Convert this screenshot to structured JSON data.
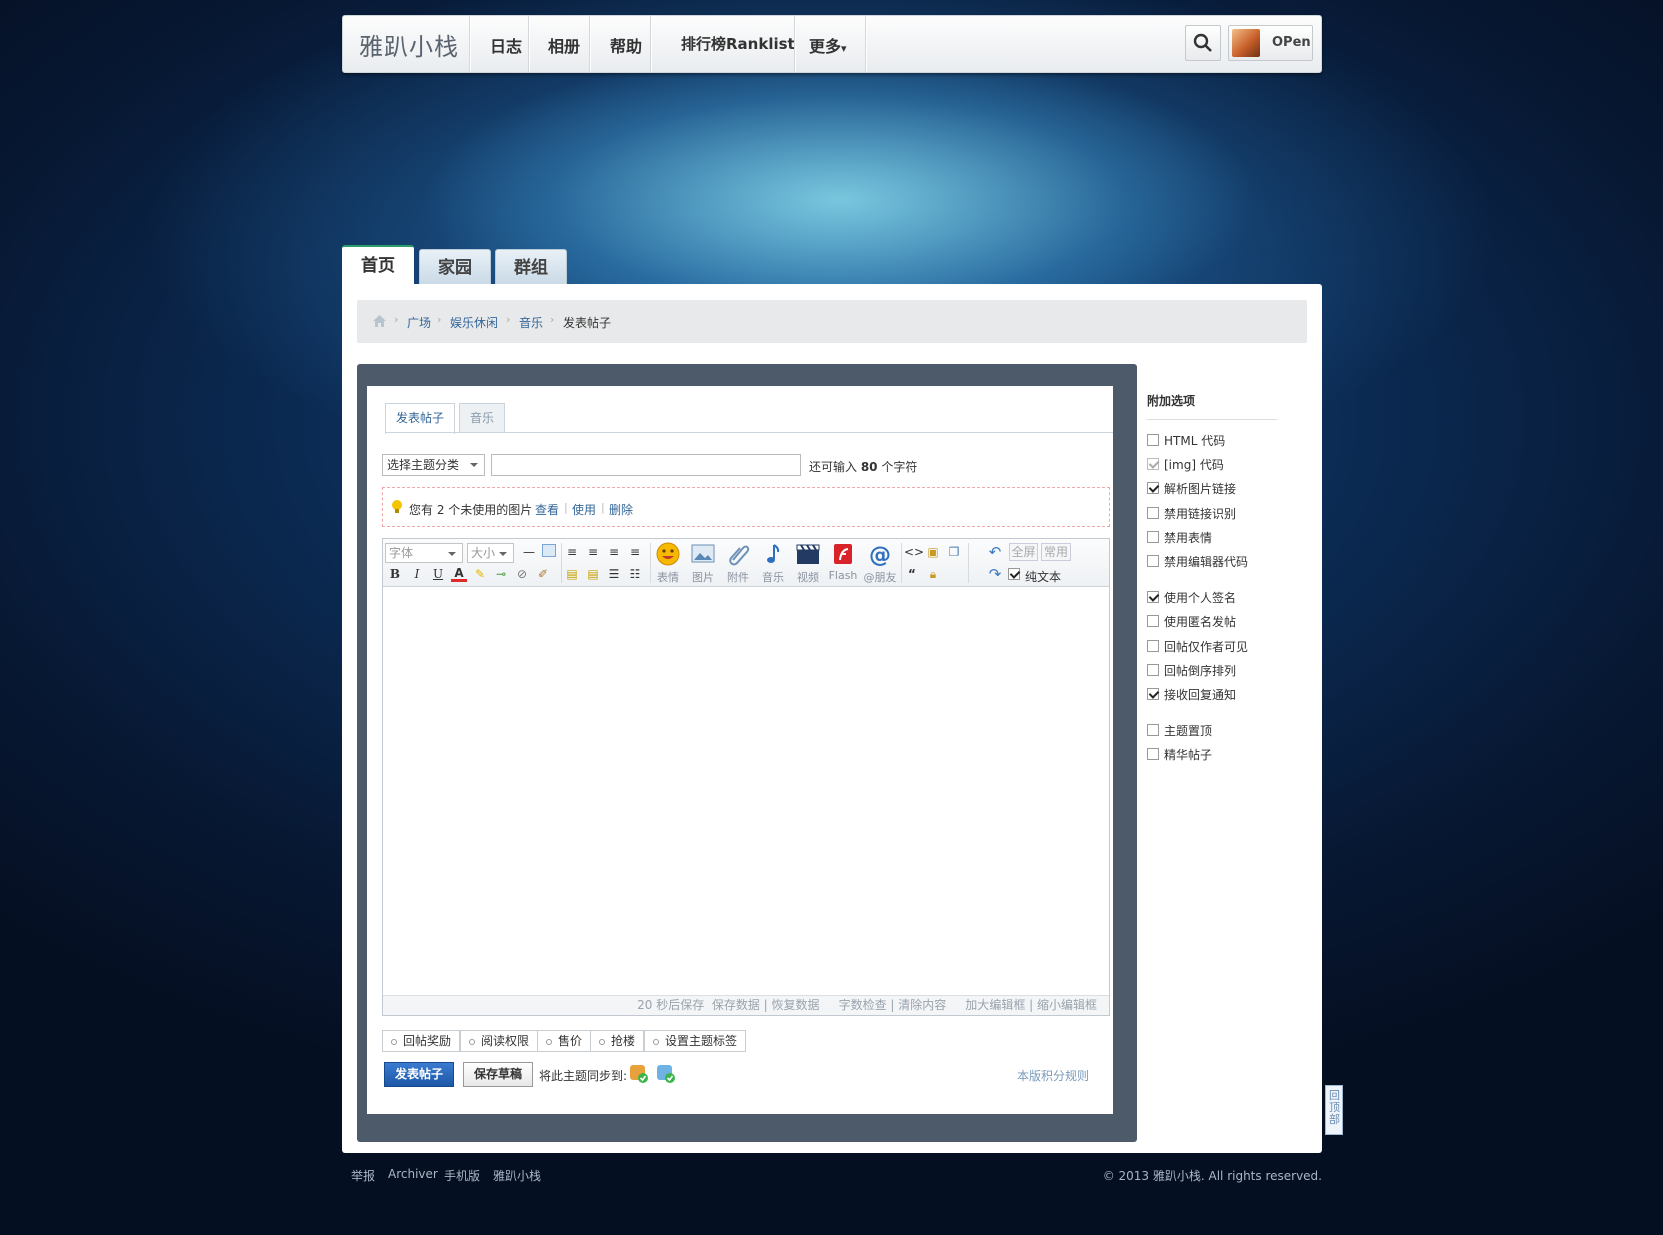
{
  "nav": {
    "logo": "雅趴小栈",
    "items": [
      "日志",
      "相册",
      "帮助",
      "排行榜Ranklist",
      "更多"
    ],
    "more_caret": "▾",
    "username": "OPen"
  },
  "tabs": [
    "首页",
    "家园",
    "群组"
  ],
  "breadcrumb": [
    "广场",
    "娱乐休闲",
    "音乐",
    "发表帖子"
  ],
  "editor_tabs": [
    "发表帖子",
    "音乐"
  ],
  "topic_select": "选择主题分类",
  "remain": {
    "prefix": "还可输入 ",
    "count": "80",
    "suffix": " 个字符"
  },
  "notice": {
    "text": "您有 2 个未使用的图片",
    "links": [
      "查看",
      "使用",
      "删除"
    ]
  },
  "toolbar": {
    "font": "字体",
    "size": "大小",
    "insert_labels": [
      "表情",
      "图片",
      "附件",
      "音乐",
      "视频",
      "Flash",
      "@朋友"
    ],
    "fullscreen": "全屏",
    "common": "常用",
    "plaintext": "纯文本"
  },
  "status_bar": "20 秒后保存  保存数据 | 恢复数据     字数检查 | 清除内容     加大编辑框 | 缩小编辑框",
  "options": [
    "回帖奖励",
    "阅读权限",
    "售价",
    "抢楼",
    "设置主题标签"
  ],
  "buttons": {
    "post": "发表帖子",
    "draft": "保存草稿"
  },
  "sync_text": "将此主题同步到:",
  "rules_link": "本版积分规则",
  "side": {
    "title": "附加选项",
    "options": [
      {
        "label": "HTML 代码",
        "checked": false
      },
      {
        "label": "[img] 代码",
        "checked": true,
        "disabled": true
      },
      {
        "label": "解析图片链接",
        "checked": true
      },
      {
        "label": "禁用链接识别",
        "checked": false
      },
      {
        "label": "禁用表情",
        "checked": false
      },
      {
        "label": "禁用编辑器代码",
        "checked": false
      },
      {
        "label": "使用个人签名",
        "checked": true
      },
      {
        "label": "使用匿名发帖",
        "checked": false
      },
      {
        "label": "回帖仅作者可见",
        "checked": false
      },
      {
        "label": "回帖倒序排列",
        "checked": false
      },
      {
        "label": "接收回复通知",
        "checked": true
      },
      {
        "label": "主题置顶",
        "checked": false
      },
      {
        "label": "精华帖子",
        "checked": false
      }
    ]
  },
  "footer": {
    "links": [
      "举报",
      "Archiver",
      "手机版",
      "雅趴小栈"
    ],
    "copyright": "© 2013 雅趴小栈. All rights reserved."
  },
  "to_top": "回顶部"
}
